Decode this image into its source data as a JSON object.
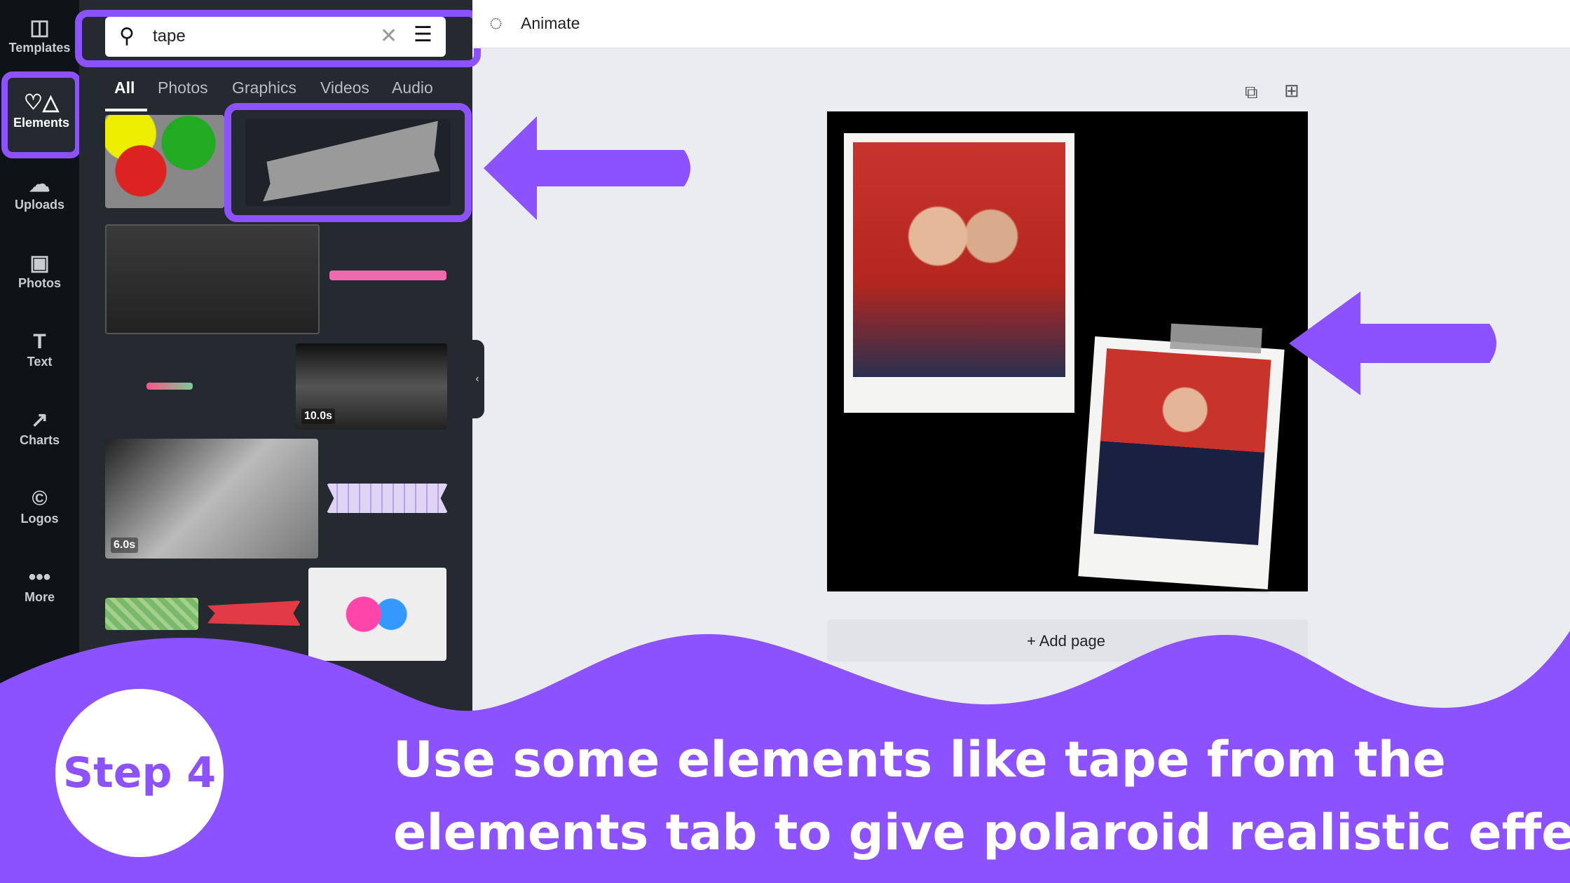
{
  "sidebar": {
    "items": [
      {
        "label": "Templates",
        "icon": "templates-icon",
        "glyph": "◫"
      },
      {
        "label": "Elements",
        "icon": "elements-icon",
        "glyph": "♡△"
      },
      {
        "label": "Uploads",
        "icon": "upload-cloud-icon",
        "glyph": "☁"
      },
      {
        "label": "Photos",
        "icon": "photos-icon",
        "glyph": "▣"
      },
      {
        "label": "Text",
        "icon": "text-icon",
        "glyph": "T"
      },
      {
        "label": "Charts",
        "icon": "charts-icon",
        "glyph": "↗"
      },
      {
        "label": "Logos",
        "icon": "logos-icon",
        "glyph": "©"
      },
      {
        "label": "More",
        "icon": "more-icon",
        "glyph": "•••"
      }
    ]
  },
  "search": {
    "value": "tape"
  },
  "tabs": [
    {
      "label": "All"
    },
    {
      "label": "Photos"
    },
    {
      "label": "Graphics"
    },
    {
      "label": "Videos"
    },
    {
      "label": "Audio"
    }
  ],
  "results": {
    "durations": [
      "10.0s",
      "6.0s"
    ]
  },
  "topbar": {
    "animate_label": "Animate"
  },
  "canvas": {
    "add_page_label": "+ Add page"
  },
  "overlay": {
    "step": "Step 4",
    "caption_line1": "Use some elements like tape from the",
    "caption_line2": "elements tab to give polaroid realistic effect.",
    "accent": "#8c52ff"
  }
}
